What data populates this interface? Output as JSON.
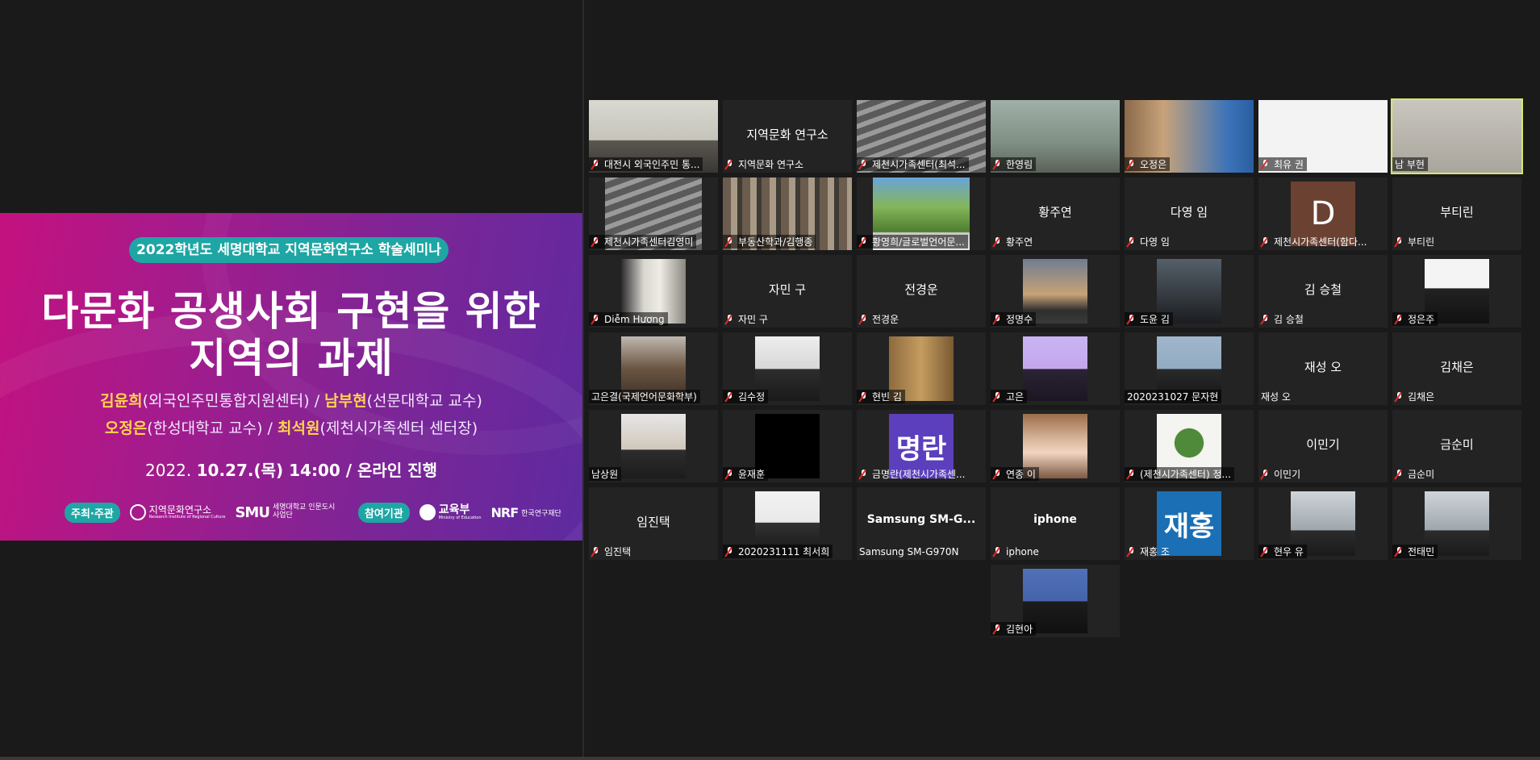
{
  "banner": {
    "pill": "2022학년도 세명대학교 지역문화연구소 학술세미나",
    "title_line1": "다문화 공생사회 구현을 위한",
    "title_line2": "지역의 과제",
    "speaker1_name": "김윤희",
    "speaker1_org": "(외국인주민통합지원센터) / ",
    "speaker2_name": "남부현",
    "speaker2_org": "(선문대학교 교수)",
    "speaker3_name": "오정은",
    "speaker3_org": "(한성대학교 교수) / ",
    "speaker4_name": "최석원",
    "speaker4_org": "(제천시가족센터 센터장)",
    "date_prefix": "2022. ",
    "date_main": "10.27.(목) 14:00 / 온라인 진행",
    "footer_host_label": "주최·주관",
    "footer_host_org": "지역문화연구소",
    "footer_host_org_en": "Research Institute of Regional Culture",
    "footer_smu": "SMU",
    "footer_smu_text": "세명대학교 인문도시사업단",
    "footer_partner_label": "참여기관",
    "footer_moe": "교육부",
    "footer_moe_en": "Ministry of Education",
    "footer_nrf": "NRF",
    "footer_nrf_text": "한국연구재단"
  },
  "tiles": [
    {
      "name": "대전시 외국인주민 통...",
      "center": "",
      "photo": "ph-room",
      "muted": true
    },
    {
      "name": "지역문화 연구소",
      "center": "지역문화 연구소",
      "photo": "",
      "muted": true
    },
    {
      "name": "제천시가족센터(최석...",
      "center": "",
      "photo": "ph-blinds",
      "muted": true
    },
    {
      "name": "한영림",
      "center": "",
      "photo": "ph-sky",
      "muted": true
    },
    {
      "name": "오정은",
      "center": "",
      "photo": "ph-books",
      "muted": true
    },
    {
      "name": "최유 권",
      "center": "",
      "photo": "ph-white",
      "muted": true
    },
    {
      "name": "남 부현",
      "center": "",
      "photo": "ph-office",
      "muted": false,
      "speaking": true
    },
    {
      "name": "제천시가족센터김영미",
      "center": "",
      "photo": "ph-blinds",
      "muted": true,
      "small": true
    },
    {
      "name": "부동산학과/김행종",
      "center": "",
      "photo": "ph-shelves",
      "muted": true
    },
    {
      "name": "황영희/글로벌언어문...",
      "center": "",
      "photo": "ph-trees",
      "muted": true,
      "small": true
    },
    {
      "name": "황주연",
      "center": "황주연",
      "photo": "",
      "muted": true
    },
    {
      "name": "다영 임",
      "center": "다영 임",
      "photo": "",
      "muted": true
    },
    {
      "name": "제천시가족센터(함다...",
      "center": "",
      "photo": "",
      "muted": true,
      "letter": "D"
    },
    {
      "name": "부티린",
      "center": "부티린",
      "photo": "",
      "muted": true
    },
    {
      "name": "Diễm Hương",
      "center": "",
      "photo": "ph-hall",
      "muted": true,
      "square": true
    },
    {
      "name": "자민 구",
      "center": "자민 구",
      "photo": "",
      "muted": true
    },
    {
      "name": "전경운",
      "center": "전경운",
      "photo": "",
      "muted": true
    },
    {
      "name": "정명수",
      "center": "",
      "photo": "ph-sunset",
      "muted": true,
      "square": true
    },
    {
      "name": "도윤 김",
      "center": "",
      "photo": "ph-dark",
      "muted": true,
      "square": true
    },
    {
      "name": "김 승철",
      "center": "김 승철",
      "photo": "",
      "muted": true
    },
    {
      "name": "정은주",
      "center": "",
      "photo": "ph-id",
      "muted": true,
      "square": true
    },
    {
      "name": "고은결(국제언어문화학부)",
      "center": "",
      "photo": "ph-hat",
      "muted": false,
      "square": true
    },
    {
      "name": "김수정",
      "center": "",
      "photo": "ph-gray",
      "muted": true,
      "square": true
    },
    {
      "name": "현빈 김",
      "center": "",
      "photo": "ph-wood",
      "muted": true,
      "square": true
    },
    {
      "name": "고은",
      "center": "",
      "photo": "ph-pink",
      "muted": true,
      "square": true
    },
    {
      "name": "2020231027 문자현",
      "center": "",
      "photo": "ph-blue-id",
      "muted": false,
      "square": true
    },
    {
      "name": "재성 오",
      "center": "재성 오",
      "photo": "",
      "muted": false
    },
    {
      "name": "김채은",
      "center": "김채은",
      "photo": "",
      "muted": true
    },
    {
      "name": "남상원",
      "center": "",
      "photo": "ph-boy",
      "muted": false,
      "square": true
    },
    {
      "name": "윤재훈",
      "center": "",
      "photo": "ph-black",
      "muted": true,
      "square": true
    },
    {
      "name": "금명란(제천시가족센...",
      "center": "",
      "photo": "",
      "muted": true,
      "textavatar": "명란"
    },
    {
      "name": "연종 이",
      "center": "",
      "photo": "ph-avatar",
      "muted": true,
      "square": true
    },
    {
      "name": "(제천시가족센터) 정...",
      "center": "",
      "photo": "ph-plant",
      "muted": true,
      "square": true
    },
    {
      "name": "이민기",
      "center": "이민기",
      "photo": "",
      "muted": true
    },
    {
      "name": "금순미",
      "center": "금순미",
      "photo": "",
      "muted": true
    },
    {
      "name": "임진택",
      "center": "임진택",
      "photo": "",
      "muted": true
    },
    {
      "name": "2020231111 최서희",
      "center": "",
      "photo": "ph-id2",
      "muted": true,
      "square": true
    },
    {
      "name": "Samsung SM-G970N",
      "center": "Samsung SM-G...",
      "photo": "",
      "muted": false
    },
    {
      "name": "iphone",
      "center": "iphone",
      "photo": "",
      "muted": true
    },
    {
      "name": "재홍 조",
      "center": "",
      "photo": "",
      "muted": true,
      "textavatar": "재홍",
      "tvblue": true
    },
    {
      "name": "현우 유",
      "center": "",
      "photo": "ph-class",
      "muted": true,
      "square": true
    },
    {
      "name": "전태민",
      "center": "",
      "photo": "ph-class",
      "muted": true,
      "square": true
    },
    {
      "name": "김현아",
      "center": "",
      "photo": "ph-id3",
      "muted": true,
      "square": true,
      "col": 3
    }
  ],
  "colors": {
    "speaking_border": "#d6e86a",
    "muted_slash": "#e02828",
    "tile_bg": "#232323"
  }
}
